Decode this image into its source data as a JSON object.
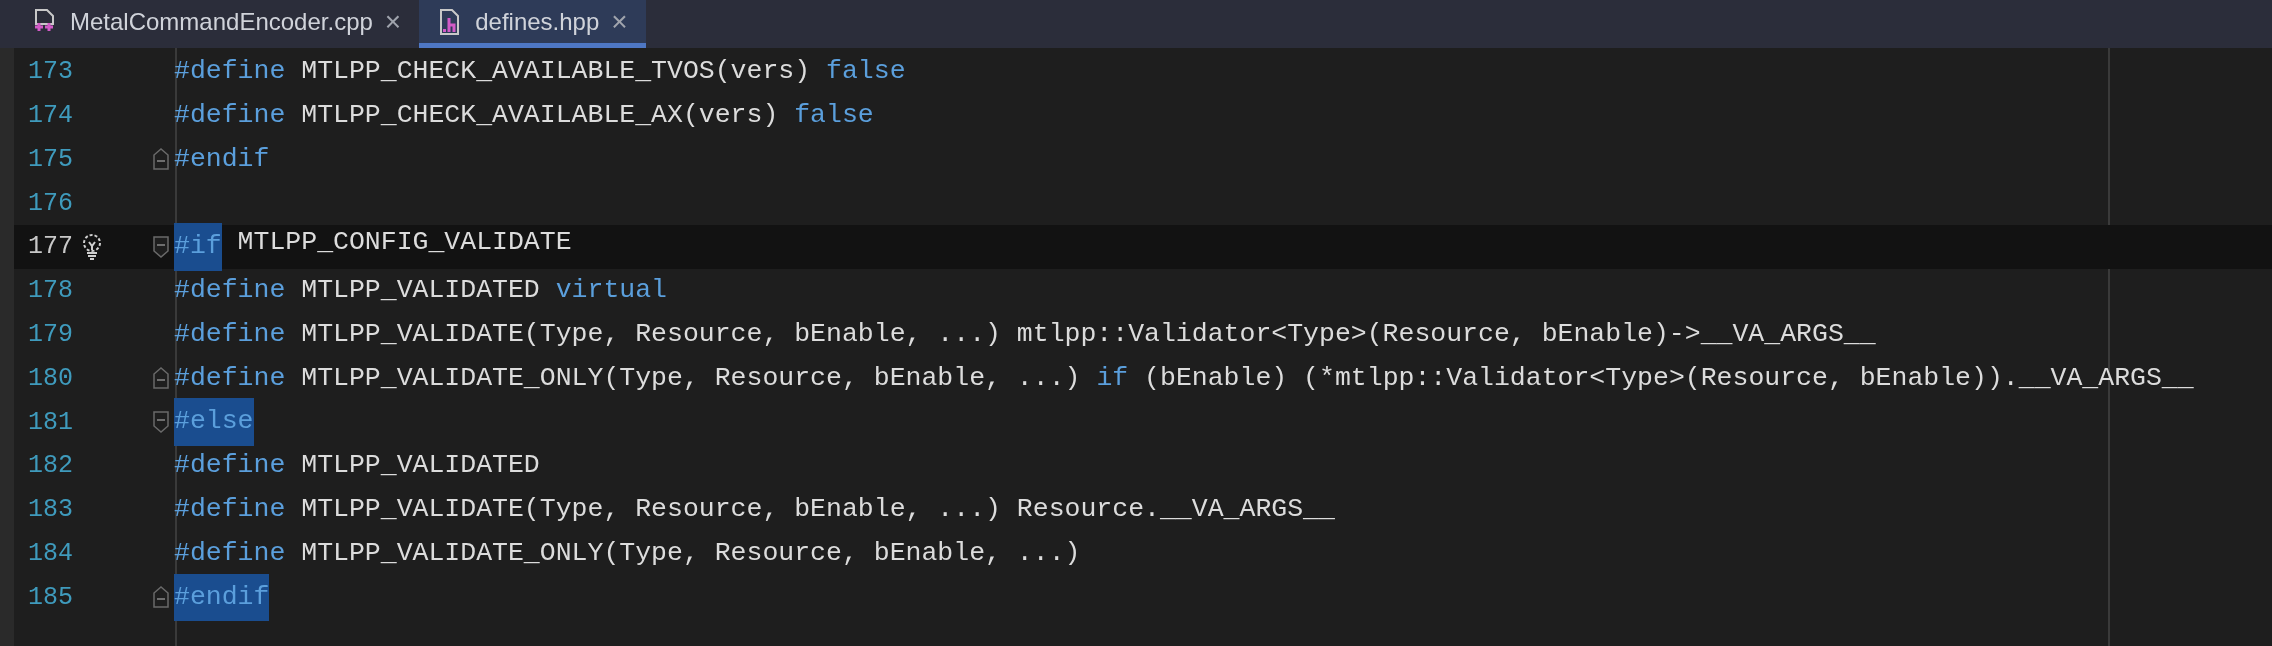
{
  "tabs": [
    {
      "label": "MetalCommandEncoder.cpp",
      "kind": "cpp",
      "close": "×",
      "selected": false
    },
    {
      "label": "defines.hpp",
      "kind": "h",
      "close": "×",
      "selected": true
    }
  ],
  "lines": [
    {
      "number": "173",
      "current": false,
      "bulb": false,
      "fold_start": false,
      "fold_end": false,
      "tokens": [
        {
          "text": "#define",
          "kind": "keyword",
          "highlighted": false
        },
        {
          "text": " MTLPP_CHECK_AVAILABLE_TVOS(vers) ",
          "kind": "plain",
          "highlighted": false
        },
        {
          "text": "false",
          "kind": "keyword",
          "highlighted": false
        }
      ]
    },
    {
      "number": "174",
      "current": false,
      "bulb": false,
      "fold_start": false,
      "fold_end": false,
      "tokens": [
        {
          "text": "#define",
          "kind": "keyword",
          "highlighted": false
        },
        {
          "text": " MTLPP_CHECK_AVAILABLE_AX(vers) ",
          "kind": "plain",
          "highlighted": false
        },
        {
          "text": "false",
          "kind": "keyword",
          "highlighted": false
        }
      ]
    },
    {
      "number": "175",
      "current": false,
      "bulb": false,
      "fold_start": false,
      "fold_end": true,
      "tokens": [
        {
          "text": "#endif",
          "kind": "keyword",
          "highlighted": false
        }
      ]
    },
    {
      "number": "176",
      "current": false,
      "bulb": false,
      "fold_start": false,
      "fold_end": false
    },
    {
      "number": "177",
      "current": true,
      "bulb": true,
      "fold_start": true,
      "fold_end": false,
      "tokens": [
        {
          "text": "#if",
          "kind": "keyword",
          "highlighted": true
        },
        {
          "text": " MTLPP_CONFIG_VALIDATE",
          "kind": "plain",
          "highlighted": false
        }
      ]
    },
    {
      "number": "178",
      "current": false,
      "bulb": false,
      "fold_start": false,
      "fold_end": false,
      "tokens": [
        {
          "text": "#define",
          "kind": "keyword",
          "highlighted": false
        },
        {
          "text": " MTLPP_VALIDATED ",
          "kind": "plain",
          "highlighted": false
        },
        {
          "text": "virtual",
          "kind": "keyword",
          "highlighted": false
        }
      ]
    },
    {
      "number": "179",
      "current": false,
      "bulb": false,
      "fold_start": false,
      "fold_end": false,
      "tokens": [
        {
          "text": "#define",
          "kind": "keyword",
          "highlighted": false
        },
        {
          "text": " MTLPP_VALIDATE(Type, Resource, bEnable, ...) mtlpp::Validator<Type>(Resource, bEnable)->__VA_ARGS__",
          "kind": "plain",
          "highlighted": false
        }
      ]
    },
    {
      "number": "180",
      "current": false,
      "bulb": false,
      "fold_start": false,
      "fold_end": true,
      "tokens": [
        {
          "text": "#define",
          "kind": "keyword",
          "highlighted": false
        },
        {
          "text": " MTLPP_VALIDATE_ONLY(Type, Resource, bEnable, ...) ",
          "kind": "plain",
          "highlighted": false
        },
        {
          "text": "if",
          "kind": "keyword",
          "highlighted": false
        },
        {
          "text": " (bEnable) (*mtlpp::Validator<Type>(Resource, bEnable)).__VA_ARGS__",
          "kind": "plain",
          "highlighted": false
        }
      ]
    },
    {
      "number": "181",
      "current": false,
      "bulb": false,
      "fold_start": true,
      "fold_end": false,
      "tokens": [
        {
          "text": "#else",
          "kind": "keyword",
          "highlighted": true
        }
      ]
    },
    {
      "number": "182",
      "current": false,
      "bulb": false,
      "fold_start": false,
      "fold_end": false,
      "tokens": [
        {
          "text": "#define",
          "kind": "keyword",
          "highlighted": false
        },
        {
          "text": " MTLPP_VALIDATED",
          "kind": "plain",
          "highlighted": false
        }
      ]
    },
    {
      "number": "183",
      "current": false,
      "bulb": false,
      "fold_start": false,
      "fold_end": false,
      "tokens": [
        {
          "text": "#define",
          "kind": "keyword",
          "highlighted": false
        },
        {
          "text": " MTLPP_VALIDATE(Type, Resource, bEnable, ...) Resource.__VA_ARGS__",
          "kind": "plain",
          "highlighted": false
        }
      ]
    },
    {
      "number": "184",
      "current": false,
      "bulb": false,
      "fold_start": false,
      "fold_end": false,
      "tokens": [
        {
          "text": "#define",
          "kind": "keyword",
          "highlighted": false
        },
        {
          "text": " MTLPP_VALIDATE_ONLY(Type, Resource, bEnable, ...)",
          "kind": "plain",
          "highlighted": false
        }
      ]
    },
    {
      "number": "185",
      "current": false,
      "bulb": false,
      "fold_start": false,
      "fold_end": true,
      "tokens": [
        {
          "text": "#endif",
          "kind": "keyword",
          "highlighted": true
        }
      ]
    }
  ]
}
